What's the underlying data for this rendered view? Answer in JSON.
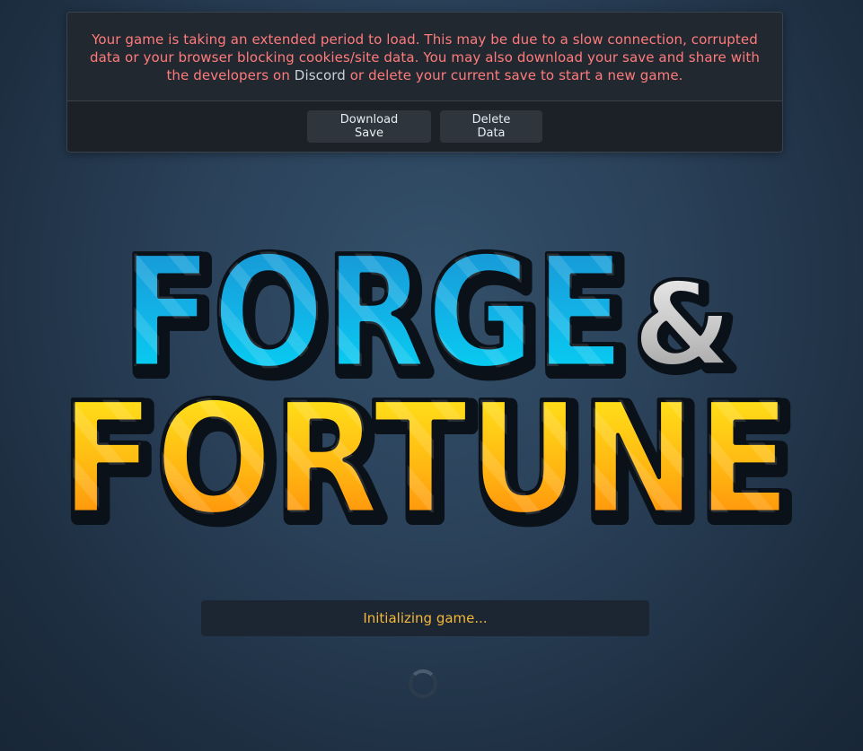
{
  "warning": {
    "message_part1": "Your game is taking an extended period to load. This may be due to a slow connection, corrupted data or your browser blocking cookies/site data. You may also download your save and share with the developers on ",
    "discord_link": "Discord",
    "message_part2": " or delete your current save to start a new game.",
    "download_label": "Download Save",
    "delete_label": "Delete Data"
  },
  "logo": {
    "line1": "FORGE",
    "ampersand": "&",
    "line2": "FORTUNE"
  },
  "status": {
    "text": "Initializing game..."
  },
  "colors": {
    "warning_text": "#ff7b7b",
    "status_text": "#f4b73a",
    "logo_blue_top": "#1ea5dc",
    "logo_blue_bottom": "#00d4f5",
    "logo_gold_top": "#ffe41a",
    "logo_gold_bottom": "#ff8a0a"
  },
  "icons": {
    "spinner": "loading-spinner-icon"
  }
}
